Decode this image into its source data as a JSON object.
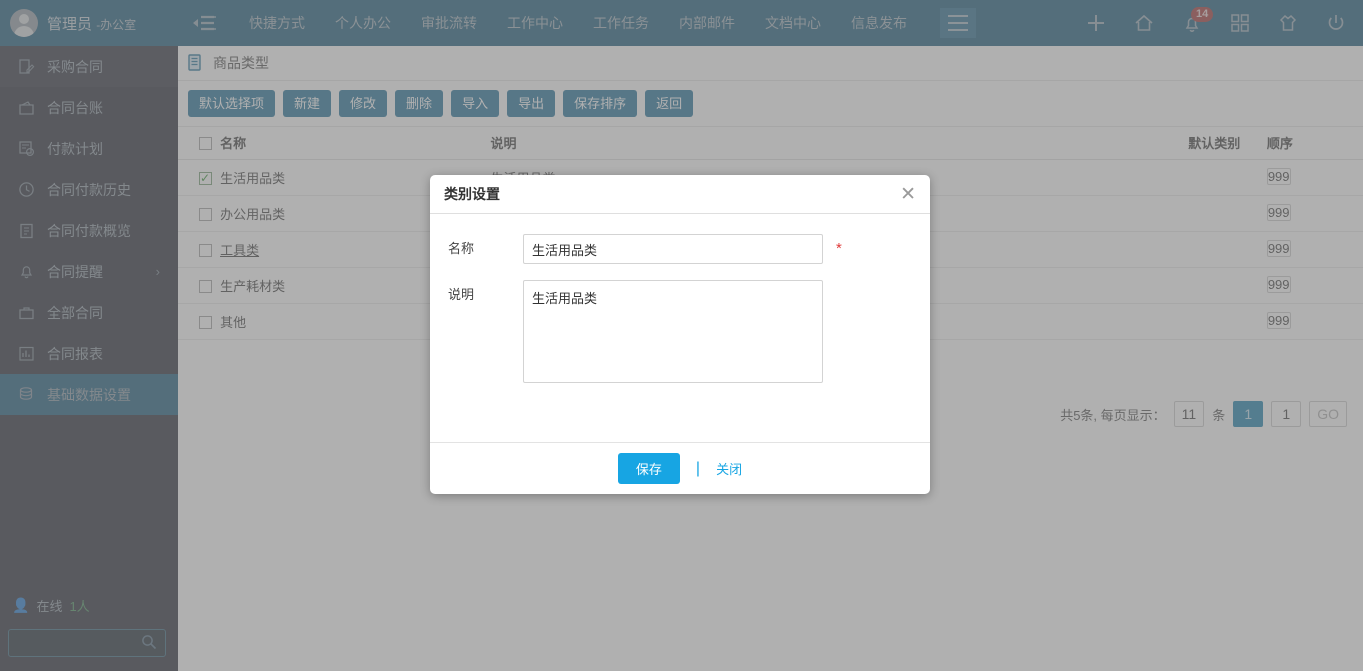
{
  "topbar": {
    "user_name": "管理员",
    "user_dept": "-办公室",
    "nav": [
      {
        "label": "快捷方式"
      },
      {
        "label": "个人办公"
      },
      {
        "label": "审批流转"
      },
      {
        "label": "工作中心"
      },
      {
        "label": "工作任务"
      },
      {
        "label": "内部邮件"
      },
      {
        "label": "文档中心"
      },
      {
        "label": "信息发布"
      }
    ],
    "notification_count": "14",
    "icons": {
      "menu_list": "menu-list-icon",
      "hamburger": "hamburger-icon",
      "add": "plus-icon",
      "home": "home-icon",
      "bell": "bell-icon",
      "apps": "apps-grid-icon",
      "shirt": "shirt-icon",
      "power": "power-icon"
    }
  },
  "sidebar": {
    "items": [
      {
        "label": "采购合同",
        "icon": "contract-edit-icon",
        "section": true,
        "active": false,
        "chevron": false
      },
      {
        "label": "合同台账",
        "icon": "wallet-icon",
        "section": false,
        "active": false,
        "chevron": false
      },
      {
        "label": "付款计划",
        "icon": "payment-plan-icon",
        "section": false,
        "active": false,
        "chevron": false
      },
      {
        "label": "合同付款历史",
        "icon": "clock-icon",
        "section": false,
        "active": false,
        "chevron": false
      },
      {
        "label": "合同付款概览",
        "icon": "clipboard-icon",
        "section": false,
        "active": false,
        "chevron": false
      },
      {
        "label": "合同提醒",
        "icon": "bell-icon",
        "section": false,
        "active": false,
        "chevron": true
      },
      {
        "label": "全部合同",
        "icon": "briefcase-icon",
        "section": false,
        "active": false,
        "chevron": false
      },
      {
        "label": "合同报表",
        "icon": "chart-icon",
        "section": false,
        "active": false,
        "chevron": false
      },
      {
        "label": "基础数据设置",
        "icon": "database-icon",
        "section": false,
        "active": true,
        "chevron": false
      }
    ],
    "online_label": "在线",
    "online_count": "1人",
    "search_value": "",
    "search_placeholder": ""
  },
  "page": {
    "title": "商品类型",
    "title_icon": "document-list-icon",
    "toolbar": [
      {
        "label": "默认选择项"
      },
      {
        "label": "新建"
      },
      {
        "label": "修改"
      },
      {
        "label": "删除"
      },
      {
        "label": "导入"
      },
      {
        "label": "导出"
      },
      {
        "label": "保存排序"
      },
      {
        "label": "返回"
      }
    ],
    "columns": [
      "名称",
      "说明",
      "默认类别",
      "顺序"
    ],
    "rows": [
      {
        "checked": true,
        "name": "生活用品类",
        "desc": "生活用品类",
        "default_type": "",
        "order": "999",
        "hover": false
      },
      {
        "checked": false,
        "name": "办公用品类",
        "desc": "",
        "default_type": "",
        "order": "999",
        "hover": false
      },
      {
        "checked": false,
        "name": "工具类",
        "desc": "",
        "default_type": "",
        "order": "999",
        "hover": true
      },
      {
        "checked": false,
        "name": "生产耗材类",
        "desc": "",
        "default_type": "",
        "order": "999",
        "hover": false
      },
      {
        "checked": false,
        "name": "其他",
        "desc": "",
        "default_type": "",
        "order": "999",
        "hover": false
      }
    ],
    "pager": {
      "total_text": "共5条, 每页显示：",
      "page_size": "11",
      "unit": "条",
      "current_page": "1",
      "goto_value": "1",
      "go_label": "GO"
    }
  },
  "modal": {
    "title": "类别设置",
    "close_icon": "close-icon",
    "fields": [
      {
        "label": "名称",
        "value": "生活用品类",
        "required": true
      },
      {
        "label": "说明",
        "value": "生活用品类",
        "required": false
      }
    ],
    "save_label": "保存",
    "close_label": "关闭",
    "accent_color": "#17a5e3"
  }
}
